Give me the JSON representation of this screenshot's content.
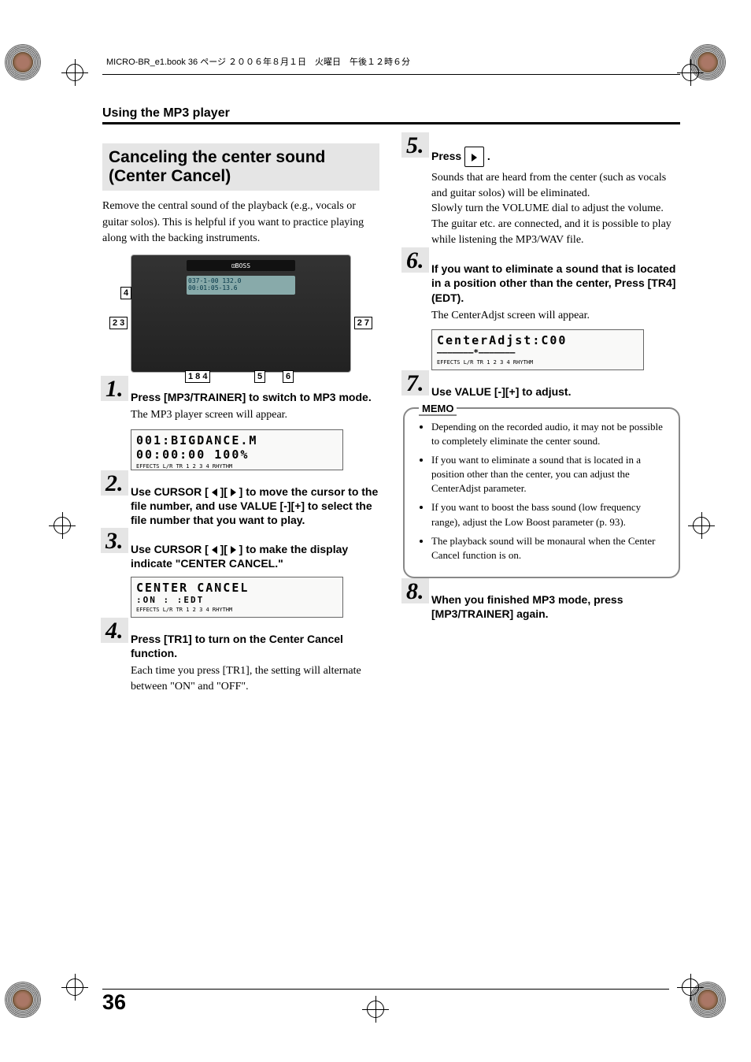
{
  "meta": {
    "header": "MICRO-BR_e1.book 36 ページ ２００６年８月１日　火曜日　午後１２時６分"
  },
  "section": {
    "title": "Using the MP3 player"
  },
  "feature": {
    "title": "Canceling the center sound (Center Cancel)",
    "intro": "Remove the central sound of the playback (e.g., vocals or guitar solos). This is helpful if you want to practice playing along with the backing instruments."
  },
  "device": {
    "screen1": "037-1-00 132.0",
    "screen2": "00:01:05-13.6",
    "callouts": [
      "4",
      "2",
      "3",
      "2",
      "7",
      "1",
      "8",
      "4",
      "5",
      "6"
    ]
  },
  "steps": {
    "s1": {
      "num": "1.",
      "head": "Press [MP3/TRAINER] to switch to MP3 mode.",
      "body": "The MP3 player screen will appear."
    },
    "s1_lcd": {
      "l1": "001:BIGDANCE.M",
      "l2": "00:00:00 100%",
      "foot": "EFFECTS  L/R  TR 1  2  3  4  RHYTHM"
    },
    "s2": {
      "num": "2.",
      "head_a": "Use CURSOR [ ",
      "head_b": " ][ ",
      "head_c": " ] to move the cursor to the file number, and use VALUE [-][+] to select the file number that you want to play."
    },
    "s3": {
      "num": "3.",
      "head_a": "Use CURSOR [ ",
      "head_b": " ][ ",
      "head_c": " ] to make the display indicate \"CENTER CANCEL.\""
    },
    "s3_lcd": {
      "l1": "CENTER CANCEL",
      "l2": ":ON :          :EDT",
      "foot": "EFFECTS  L/R  TR 1  2  3  4  RHYTHM"
    },
    "s4": {
      "num": "4.",
      "head": "Press [TR1] to turn on the Center Cancel function.",
      "body": "Each time you press [TR1], the setting will alternate between \"ON\" and \"OFF\"."
    },
    "s5": {
      "num": "5.",
      "head_a": "Press ",
      "head_b": " .",
      "body1": "Sounds that are heard from the center (such as vocals and guitar solos) will be eliminated.",
      "body2": "Slowly turn the VOLUME dial to adjust the volume.",
      "body3": "The guitar etc. are connected, and it is possible to play while listening the MP3/WAV file."
    },
    "s6": {
      "num": "6.",
      "head": "If you want to eliminate a sound that is located in a position other than the center, Press [TR4] (EDT).",
      "body": "The CenterAdjst screen will appear."
    },
    "s6_lcd": {
      "l1": "CenterAdjst:C00",
      "l2": "———————*———————",
      "foot": "EFFECTS  L/R  TR 1  2  3  4  RHYTHM"
    },
    "s7": {
      "num": "7.",
      "head": "Use VALUE [-][+] to adjust."
    },
    "s8": {
      "num": "8.",
      "head": "When you finished MP3 mode, press [MP3/TRAINER] again."
    }
  },
  "memo": {
    "label": "MEMO",
    "b1": "Depending on the recorded audio, it may not be possible to completely eliminate the center sound.",
    "b2": "If you want to eliminate a sound that is located in a position other than the center, you can adjust the CenterAdjst parameter.",
    "b3": "If you want to boost the bass sound (low frequency range), adjust the Low Boost parameter (p. 93).",
    "b4": "The playback sound will be monaural when the Center Cancel function is on."
  },
  "page_number": "36"
}
